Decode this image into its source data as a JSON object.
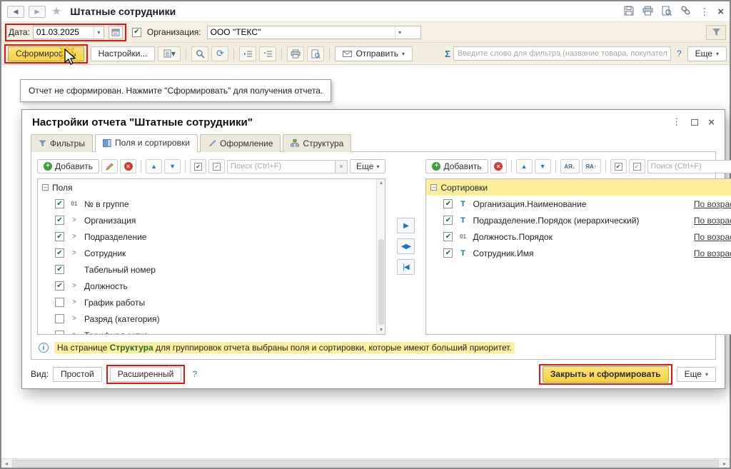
{
  "icons": {
    "back": "◀",
    "forward": "▶",
    "favorite_star": "★",
    "more_vertical": "⋮",
    "close": "×",
    "dropdown": "▾",
    "refresh": "⟳",
    "sigma": "Σ",
    "check": "✔",
    "up": "▲",
    "down": "▼",
    "chevron": ">",
    "text_type": "Т",
    "number_type": "01",
    "sort_az": "АЯ↓",
    "sort_za": "ЯА↑",
    "move_right": "▶",
    "move_both": "◀▶",
    "move_left_all": "|◀",
    "collapse": "−",
    "scroll_left": "◂",
    "scroll_right": "▸",
    "info": "i",
    "plus": "+",
    "x": "×",
    "help": "?"
  },
  "titlebar": {
    "title": "Штатные сотрудники"
  },
  "filterbar": {
    "date_label": "Дата:",
    "date_value": "01.03.2025",
    "org_label": "Организация:",
    "org_value": "ООО \"ТЕКС\""
  },
  "toolbar": {
    "generate_label": "Сформировать",
    "settings_label": "Настройки...",
    "send_label": "Отправить",
    "filter_placeholder": "Введите слово для фильтра (название товара, покупателя и ...",
    "help_label": "?",
    "more_label": "Еще"
  },
  "report_message": "Отчет не сформирован. Нажмите \"Сформировать\" для получения отчета.",
  "dialog": {
    "title": "Настройки отчета \"Штатные сотрудники\"",
    "tabs": [
      {
        "label": "Фильтры"
      },
      {
        "label": "Поля и сортировки"
      },
      {
        "label": "Оформление"
      },
      {
        "label": "Структура"
      }
    ],
    "fields_panel": {
      "add_label": "Добавить",
      "search_placeholder": "Поиск (Ctrl+F)",
      "more_label": "Еще",
      "root_label": "Поля",
      "items": [
        {
          "checked": true,
          "icon": "num",
          "label": "№ в группе"
        },
        {
          "checked": true,
          "icon": "expand",
          "label": "Организация"
        },
        {
          "checked": true,
          "icon": "expand",
          "label": "Подразделение"
        },
        {
          "checked": true,
          "icon": "expand",
          "label": "Сотрудник"
        },
        {
          "checked": true,
          "icon": "none",
          "label": "Табельный номер"
        },
        {
          "checked": true,
          "icon": "expand",
          "label": "Должность"
        },
        {
          "checked": false,
          "icon": "expand",
          "label": "График работы"
        },
        {
          "checked": false,
          "icon": "expand",
          "label": "Разряд (категория)"
        },
        {
          "checked": false,
          "icon": "expand",
          "label": "Тарифная сетка"
        }
      ]
    },
    "sort_panel": {
      "add_label": "Добавить",
      "search_placeholder": "Поиск (Ctrl+F)",
      "root_label": "Сортировки",
      "items": [
        {
          "checked": true,
          "icon": "T",
          "label": "Организация.Наименование",
          "order": "По возрастанию"
        },
        {
          "checked": true,
          "icon": "T",
          "label": "Подразделение.Порядок (иерархический)",
          "order": "По возрастанию"
        },
        {
          "checked": true,
          "icon": "num",
          "label": "Должность.Порядок",
          "order": "По возрастанию"
        },
        {
          "checked": true,
          "icon": "T",
          "label": "Сотрудник.Имя",
          "order": "По возрастанию"
        }
      ]
    },
    "info_text": {
      "prefix": "На странице ",
      "link": "Структура",
      "suffix": " для группировок отчета выбраны поля и сортировки, которые имеют больший приоритет."
    },
    "footer": {
      "view_label": "Вид:",
      "simple_label": "Простой",
      "extended_label": "Расширенный",
      "help_label": "?",
      "submit_label": "Закрыть и сформировать",
      "more_label": "Еще"
    }
  }
}
